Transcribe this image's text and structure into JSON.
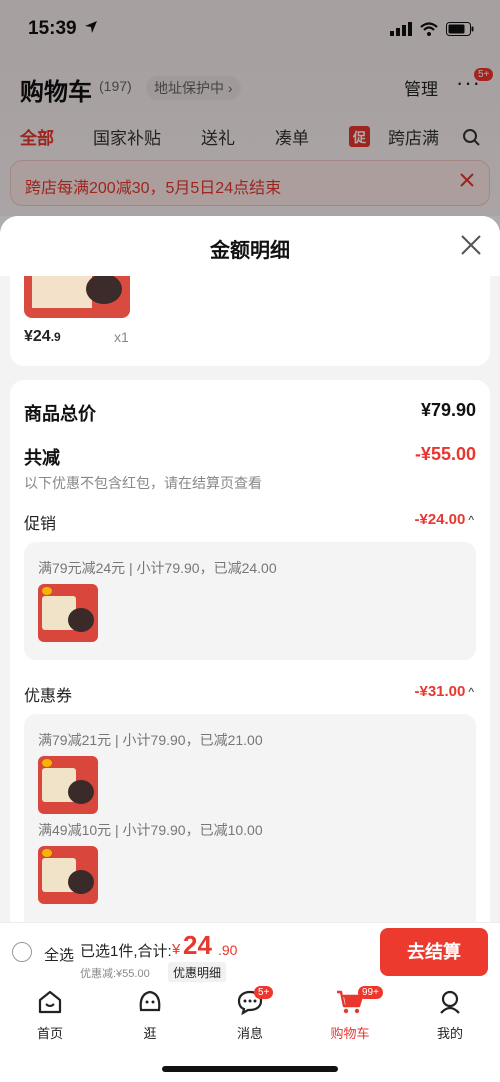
{
  "status": {
    "time": "15:39"
  },
  "header": {
    "title": "购物车",
    "count": "(197)",
    "address": "地址保护中",
    "manage": "管理",
    "more_badge": "5+"
  },
  "tabs": [
    {
      "label": "全部"
    },
    {
      "label": "国家补贴"
    },
    {
      "label": "送礼"
    },
    {
      "label": "凑单"
    },
    {
      "label": "跨店满"
    }
  ],
  "promo_tag": "促",
  "notice": {
    "text": "跨店每满200减30，5月5日24点结束"
  },
  "sheet": {
    "title": "金额明细",
    "top_item": {
      "price_main": "¥24",
      "price_dec": ".9",
      "qty": "x1"
    },
    "total_label": "商品总价",
    "total_value": "¥79.90",
    "reduce_label": "共减",
    "reduce_value": "-¥55.00",
    "reduce_note": "以下优惠不包含红包，请在结算页查看",
    "promotion": {
      "label": "促销",
      "value": "-¥24.00",
      "rule": "满79元减24元 | 小计79.90，已减24.00"
    },
    "coupon": {
      "label": "优惠券",
      "value": "-¥31.00",
      "rules": [
        "满79减21元 | 小计79.90，已减21.00",
        "满49减10元 | 小计79.90，已减10.00"
      ]
    }
  },
  "checkout": {
    "select_all": "全选",
    "summary": "已选1件,合计:",
    "currency": "¥",
    "amount": "24",
    "decimal": ".90",
    "discount_note": "优惠减:¥55.00",
    "detail_link": "优惠明细",
    "button": "去结算"
  },
  "tabbar": [
    {
      "label": "首页",
      "icon": "home-icon"
    },
    {
      "label": "逛",
      "icon": "browse-icon"
    },
    {
      "label": "消息",
      "icon": "message-icon",
      "badge": "5+"
    },
    {
      "label": "购物车",
      "icon": "cart-icon",
      "badge": "99+"
    },
    {
      "label": "我的",
      "icon": "profile-icon"
    }
  ],
  "colors": {
    "accent": "#e8372f",
    "button": "#ec3b2e"
  }
}
